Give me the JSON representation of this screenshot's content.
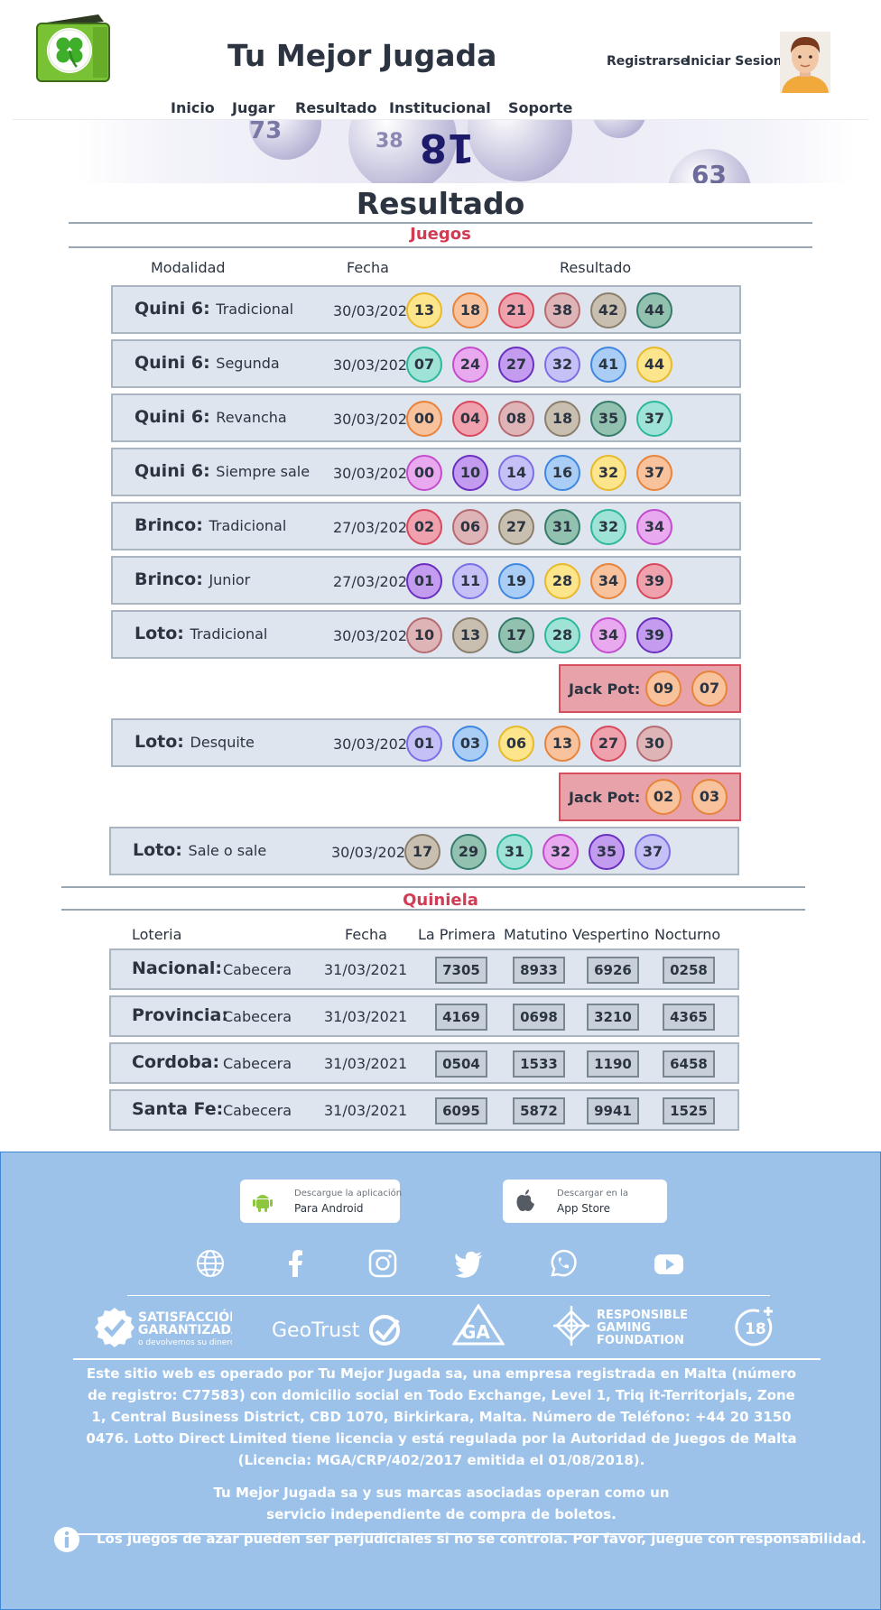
{
  "header": {
    "title": "Tu Mejor Jugada",
    "register_label": "Registrarse",
    "login_label": "Iniciar Sesion",
    "nav": [
      "Inicio",
      "Jugar",
      "Resultado",
      "Institucional",
      "Soporte"
    ]
  },
  "banner": {
    "ball_numbers": [
      "18",
      "73",
      "63",
      "38"
    ]
  },
  "results": {
    "title": "Resultado",
    "games_section_title": "Juegos",
    "columns": {
      "mode": "Modalidad",
      "date": "Fecha",
      "result": "Resultado"
    },
    "jackpot_label": "Jack Pot:",
    "rows": [
      {
        "game": "Quini 6:",
        "mode": "Tradicional",
        "date": "30/03/2021",
        "balls": [
          {
            "n": "13",
            "c": "yellow"
          },
          {
            "n": "18",
            "c": "orange"
          },
          {
            "n": "21",
            "c": "red"
          },
          {
            "n": "38",
            "c": "rose"
          },
          {
            "n": "42",
            "c": "tan"
          },
          {
            "n": "44",
            "c": "darkteal"
          }
        ]
      },
      {
        "game": "Quini 6:",
        "mode": "Segunda",
        "date": "30/03/2021",
        "balls": [
          {
            "n": "07",
            "c": "teal"
          },
          {
            "n": "24",
            "c": "magenta"
          },
          {
            "n": "27",
            "c": "purple"
          },
          {
            "n": "32",
            "c": "lavender"
          },
          {
            "n": "41",
            "c": "blue"
          },
          {
            "n": "44",
            "c": "yellow"
          }
        ]
      },
      {
        "game": "Quini 6:",
        "mode": "Revancha",
        "date": "30/03/2021",
        "balls": [
          {
            "n": "00",
            "c": "orange"
          },
          {
            "n": "04",
            "c": "red"
          },
          {
            "n": "08",
            "c": "rose"
          },
          {
            "n": "18",
            "c": "tan"
          },
          {
            "n": "35",
            "c": "darkteal"
          },
          {
            "n": "37",
            "c": "teal"
          }
        ]
      },
      {
        "game": "Quini 6:",
        "mode": "Siempre sale",
        "date": "30/03/2021",
        "balls": [
          {
            "n": "00",
            "c": "magenta"
          },
          {
            "n": "10",
            "c": "purple"
          },
          {
            "n": "14",
            "c": "lavender"
          },
          {
            "n": "16",
            "c": "blue"
          },
          {
            "n": "32",
            "c": "yellow"
          },
          {
            "n": "37",
            "c": "orange"
          }
        ]
      },
      {
        "game": "Brinco:",
        "mode": "Tradicional",
        "date": "27/03/2021",
        "balls": [
          {
            "n": "02",
            "c": "red"
          },
          {
            "n": "06",
            "c": "rose"
          },
          {
            "n": "27",
            "c": "tan"
          },
          {
            "n": "31",
            "c": "darkteal"
          },
          {
            "n": "32",
            "c": "teal"
          },
          {
            "n": "34",
            "c": "magenta"
          }
        ]
      },
      {
        "game": "Brinco:",
        "mode": "Junior",
        "date": "27/03/2021",
        "balls": [
          {
            "n": "01",
            "c": "purple"
          },
          {
            "n": "11",
            "c": "lavender"
          },
          {
            "n": "19",
            "c": "blue"
          },
          {
            "n": "28",
            "c": "yellow"
          },
          {
            "n": "34",
            "c": "orange"
          },
          {
            "n": "39",
            "c": "red"
          }
        ]
      },
      {
        "game": "Loto:",
        "mode": "Tradicional",
        "date": "30/03/2021",
        "balls": [
          {
            "n": "10",
            "c": "rose"
          },
          {
            "n": "13",
            "c": "tan"
          },
          {
            "n": "17",
            "c": "darkteal"
          },
          {
            "n": "28",
            "c": "teal"
          },
          {
            "n": "34",
            "c": "magenta"
          },
          {
            "n": "39",
            "c": "purple"
          }
        ],
        "jackpot": [
          {
            "n": "09",
            "c": "orange"
          },
          {
            "n": "07",
            "c": "orange"
          }
        ]
      },
      {
        "game": "Loto:",
        "mode": "Desquite",
        "date": "30/03/2021",
        "balls": [
          {
            "n": "01",
            "c": "lavender"
          },
          {
            "n": "03",
            "c": "blue"
          },
          {
            "n": "06",
            "c": "yellow"
          },
          {
            "n": "13",
            "c": "orange"
          },
          {
            "n": "27",
            "c": "red"
          },
          {
            "n": "30",
            "c": "rose"
          }
        ],
        "jackpot": [
          {
            "n": "02",
            "c": "orange"
          },
          {
            "n": "03",
            "c": "orange"
          }
        ]
      },
      {
        "game": "Loto:",
        "mode": "Sale o sale",
        "date": "30/03/2021",
        "balls": [
          {
            "n": "17",
            "c": "tan"
          },
          {
            "n": "29",
            "c": "darkteal"
          },
          {
            "n": "31",
            "c": "teal"
          },
          {
            "n": "32",
            "c": "magenta"
          },
          {
            "n": "35",
            "c": "purple"
          },
          {
            "n": "37",
            "c": "lavender"
          }
        ]
      }
    ]
  },
  "ball_colors": {
    "yellow": {
      "fill": "#fde58c",
      "stroke": "#e8b92a"
    },
    "orange": {
      "fill": "#f7c29c",
      "stroke": "#e8833b"
    },
    "red": {
      "fill": "#efa2ad",
      "stroke": "#d8485c"
    },
    "rose": {
      "fill": "#dfb4b6",
      "stroke": "#b56b71"
    },
    "tan": {
      "fill": "#c9bfb0",
      "stroke": "#8b7f6c"
    },
    "darkteal": {
      "fill": "#93c1b0",
      "stroke": "#357b6b"
    },
    "teal": {
      "fill": "#9fe3d6",
      "stroke": "#2db89e"
    },
    "magenta": {
      "fill": "#e8a9ee",
      "stroke": "#c34ccf"
    },
    "purple": {
      "fill": "#c39cf0",
      "stroke": "#6a2ec0"
    },
    "lavender": {
      "fill": "#c5c1f7",
      "stroke": "#7b6fe6"
    },
    "blue": {
      "fill": "#a9cdf4",
      "stroke": "#3f87e0"
    }
  },
  "quiniela": {
    "title": "Quiniela",
    "columns": {
      "lottery": "Loteria",
      "date": "Fecha",
      "draws": [
        "La Primera",
        "Matutino",
        "Vespertino",
        "Nocturno"
      ]
    },
    "rows": [
      {
        "name": "Nacional:",
        "sub": "Cabecera",
        "date": "31/03/2021",
        "numbers": [
          "7305",
          "8933",
          "6926",
          "0258"
        ]
      },
      {
        "name": "Provincia:",
        "sub": "Cabecera",
        "date": "31/03/2021",
        "numbers": [
          "4169",
          "0698",
          "3210",
          "4365"
        ]
      },
      {
        "name": "Cordoba:",
        "sub": "Cabecera",
        "date": "31/03/2021",
        "numbers": [
          "0504",
          "1533",
          "1190",
          "6458"
        ]
      },
      {
        "name": "Santa Fe:",
        "sub": "Cabecera",
        "date": "31/03/2021",
        "numbers": [
          "6095",
          "5872",
          "9941",
          "1525"
        ]
      }
    ]
  },
  "footer": {
    "android": {
      "small": "Descargue la aplicación",
      "big": "Para Android",
      "icon": "android-icon"
    },
    "ios": {
      "small": "Descargar en la",
      "big": "App Store",
      "icon": "apple-icon"
    },
    "social_icons": [
      "globe-icon",
      "facebook-icon",
      "instagram-icon",
      "twitter-icon",
      "whatsapp-icon",
      "youtube-icon"
    ],
    "badges": {
      "satisfaction_title_1": "SATISFACCIÓN",
      "satisfaction_title_2": "GARANTIZADA",
      "satisfaction_sub": "o devolvemos su dinero",
      "geotrust": "GeoTrust",
      "ga": "GA",
      "rgf_1": "RESPONSIBLE",
      "rgf_2": "GAMING",
      "rgf_3": "FOUNDATION",
      "age": "18"
    },
    "legal_text": "Este sitio web es operado por Tu Mejor Jugada sa, una empresa registrada en Malta (número de registro: C77583) con domicilio social en Todo Exchange, Level 1, Triq it-Territorjals, Zone 1, Central Business District, CBD 1070, Birkirkara, Malta. Número de Teléfono: +44 20 3150 0476. Lotto Direct Limited tiene licencia y está regulada por la Autoridad de Juegos de Malta (Licencia: MGA/CRP/402/2017 emitida el 01/08/2018).",
    "service_text": "Tu Mejor Jugada sa y sus marcas asociadas operan como un servicio independiente de compra de boletos.",
    "warning_text": "Los juegos de azar pueden ser perjudiciales si no se controla. Por favor, juegue con responsabilidad."
  }
}
